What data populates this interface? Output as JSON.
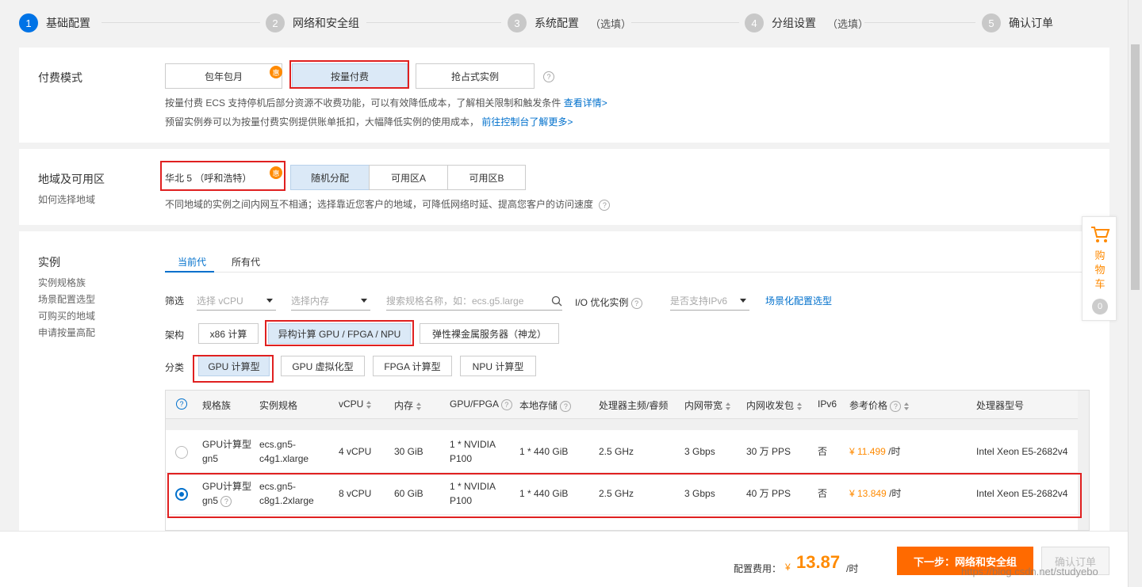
{
  "steps": [
    {
      "num": "1",
      "label": "基础配置",
      "optional": ""
    },
    {
      "num": "2",
      "label": "网络和安全组",
      "optional": ""
    },
    {
      "num": "3",
      "label": "系统配置",
      "optional": "（选填）"
    },
    {
      "num": "4",
      "label": "分组设置",
      "optional": "（选填）"
    },
    {
      "num": "5",
      "label": "确认订单",
      "optional": ""
    }
  ],
  "billing": {
    "title": "付费模式",
    "options": [
      "包年包月",
      "按量付费",
      "抢占式实例"
    ],
    "badge": "惠",
    "help": "?",
    "note1_text": "按量付费 ECS 支持停机后部分资源不收费功能，可以有效降低成本，了解相关限制和触发条件",
    "note1_link": "查看详情>",
    "note2_text": "预留实例券可以为按量付费实例提供账单抵扣，大幅降低实例的使用成本，",
    "note2_link": "前往控制台了解更多>"
  },
  "region": {
    "title": "地域及可用区",
    "subtitle": "如何选择地域",
    "selected_region": "华北 5 （呼和浩特）",
    "badge": "惠",
    "zones": [
      "随机分配",
      "可用区A",
      "可用区B"
    ],
    "note": "不同地域的实例之间内网互不相通；选择靠近您客户的地域，可降低网络时延、提高您客户的访问速度",
    "help": "?"
  },
  "instance": {
    "title": "实例",
    "side_links": [
      "实例规格族",
      "场景配置选型",
      "可购买的地域",
      "申请按量高配"
    ],
    "tabs": [
      "当前代",
      "所有代"
    ],
    "filter_label": "筛选",
    "vcpu_placeholder": "选择 vCPU",
    "mem_placeholder": "选择内存",
    "search_placeholder": "搜索规格名称，如：ecs.g5.large",
    "io_label": "I/O 优化实例",
    "ipv6_placeholder": "是否支持IPv6",
    "scene_link": "场景化配置选型",
    "arch_label": "架构",
    "arch_options": [
      "x86 计算",
      "异构计算 GPU / FPGA / NPU",
      "弹性裸金属服务器（神龙）"
    ],
    "category_label": "分类",
    "category_options": [
      "GPU 计算型",
      "GPU 虚拟化型",
      "FPGA 计算型",
      "NPU 计算型"
    ]
  },
  "table": {
    "headers": [
      "规格族",
      "实例规格",
      "vCPU",
      "内存",
      "GPU/FPGA",
      "本地存储",
      "处理器主频/睿频",
      "内网带宽",
      "内网收发包",
      "IPv6",
      "参考价格",
      "处理器型号"
    ],
    "rows": [
      {
        "family": [
          "GPU计算型",
          "gn5"
        ],
        "spec": [
          "ecs.gn5-",
          "c4g1.xlarge"
        ],
        "vcpu": "4 vCPU",
        "mem": "30 GiB",
        "gpu": [
          "1 * NVIDIA",
          "P100"
        ],
        "storage": "1 * 440 GiB",
        "freq": "2.5 GHz",
        "bw": "3 Gbps",
        "pps": "30 万 PPS",
        "ipv6": "否",
        "price": "¥ 11.499",
        "unit": "/时",
        "cpu": "Intel Xeon E5-2682v4",
        "selected": false
      },
      {
        "family": [
          "GPU计算型",
          "gn5"
        ],
        "spec": [
          "ecs.gn5-",
          "c8g1.2xlarge"
        ],
        "vcpu": "8 vCPU",
        "mem": "60 GiB",
        "gpu": [
          "1 * NVIDIA",
          "P100"
        ],
        "storage": "1 * 440 GiB",
        "freq": "2.5 GHz",
        "bw": "3 Gbps",
        "pps": "40 万 PPS",
        "ipv6": "否",
        "price": "¥ 13.849",
        "unit": "/时",
        "cpu": "Intel Xeon E5-2682v4",
        "selected": true
      }
    ]
  },
  "cart": {
    "label": "购物车",
    "count": "0"
  },
  "footer": {
    "fee_label": "配置费用：",
    "currency": "¥",
    "amount": "13.87",
    "unit": "/时",
    "next_button": "下一步：网络和安全组",
    "confirm_button": "确认订单",
    "watermark": "https://blog.csdn.net/studyebo"
  },
  "colors": {
    "accent": "#0073e6",
    "orange": "#ff8a00",
    "highlight": "#e02020"
  }
}
